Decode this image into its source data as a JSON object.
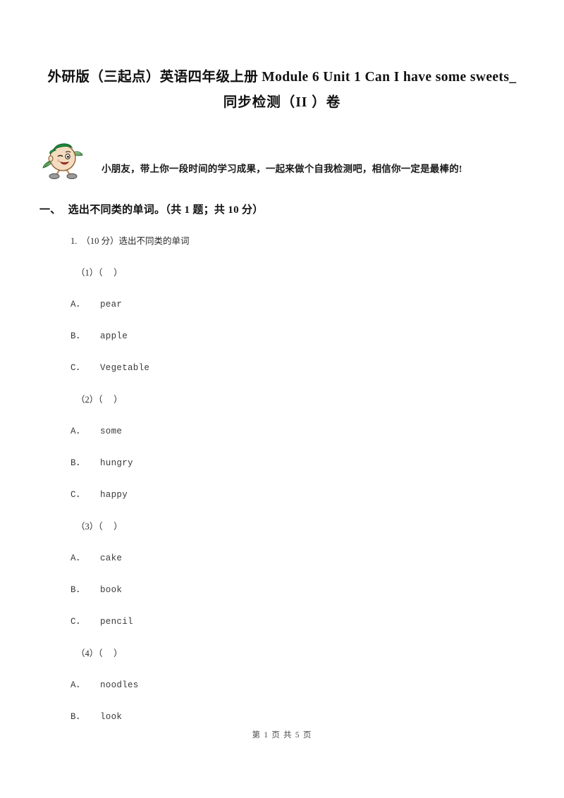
{
  "document": {
    "title_line1": "外研版（三起点）英语四年级上册 Module 6 Unit 1 Can I have some sweets_",
    "title_line2": "同步检测（II ）卷",
    "instruction": "小朋友，带上你一段时间的学习成果，一起来做个自我检测吧，相信你一定是最棒的!",
    "mascot_icon": "cartoon-student-mascot-icon"
  },
  "section": {
    "number": "一、",
    "title": "选出不同类的单词。",
    "meta": "（共 1 题；共 10 分）"
  },
  "question": {
    "number": "1.",
    "score": "（10 分）",
    "stem": "选出不同类的单词",
    "sub_questions": [
      {
        "label": "（1）（　  ）",
        "options": [
          {
            "letter": "A．",
            "text": "pear"
          },
          {
            "letter": "B．",
            "text": "apple"
          },
          {
            "letter": "C．",
            "text": "Vegetable"
          }
        ]
      },
      {
        "label": "（2）（　  ）",
        "options": [
          {
            "letter": "A．",
            "text": "some"
          },
          {
            "letter": "B．",
            "text": "hungry"
          },
          {
            "letter": "C．",
            "text": "happy"
          }
        ]
      },
      {
        "label": "（3）（　  ）",
        "options": [
          {
            "letter": "A．",
            "text": "cake"
          },
          {
            "letter": "B．",
            "text": "book"
          },
          {
            "letter": "C．",
            "text": "pencil"
          }
        ]
      },
      {
        "label": "（4）（　  ）",
        "options": [
          {
            "letter": "A．",
            "text": "noodles"
          },
          {
            "letter": "B．",
            "text": "look"
          }
        ]
      }
    ]
  },
  "footer": {
    "text": "第 1 页 共 5 页"
  },
  "colors": {
    "page_background": "#ffffff",
    "body_text": "#2a2a2a",
    "title_text": "#111111",
    "footer_text": "#4a4a4a",
    "mascot_cap": "#1f8a3b",
    "mascot_face": "#f2d9bd",
    "mascot_shoe": "#8c8c8c",
    "mascot_leaf": "#4caf50"
  }
}
